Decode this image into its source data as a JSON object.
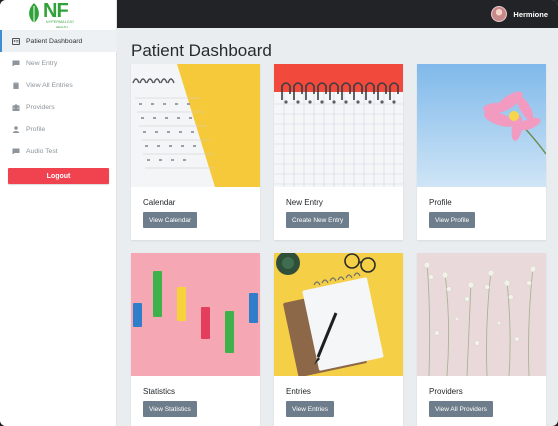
{
  "logo": {
    "text": "NF",
    "sub1": "NYPERMALGIO",
    "sub2": "HEALTH"
  },
  "user": {
    "name": "Hermione"
  },
  "sidebar": {
    "items": [
      {
        "label": "Patient Dashboard",
        "icon": "id-card-icon",
        "active": true
      },
      {
        "label": "New Entry",
        "icon": "comment-icon"
      },
      {
        "label": "View All Entries",
        "icon": "clipboard-icon"
      },
      {
        "label": "Providers",
        "icon": "hospital-icon"
      },
      {
        "label": "Profile",
        "icon": "user-icon"
      },
      {
        "label": "Audio Test",
        "icon": "comment-icon"
      }
    ],
    "logout": "Logout"
  },
  "main": {
    "title": "Patient Dashboard",
    "cards": [
      {
        "title": "Calendar",
        "button": "View Calendar"
      },
      {
        "title": "New Entry",
        "button": "Create New Entry"
      },
      {
        "title": "Profile",
        "button": "View Profile"
      },
      {
        "title": "Statistics",
        "button": "View Statistics"
      },
      {
        "title": "Entries",
        "button": "View Entries"
      },
      {
        "title": "Providers",
        "button": "View All Providers"
      }
    ]
  },
  "colors": {
    "accent": "#3d8fd1",
    "logout": "#f0434f",
    "button": "#6e7d8b",
    "topbar": "#212327"
  }
}
